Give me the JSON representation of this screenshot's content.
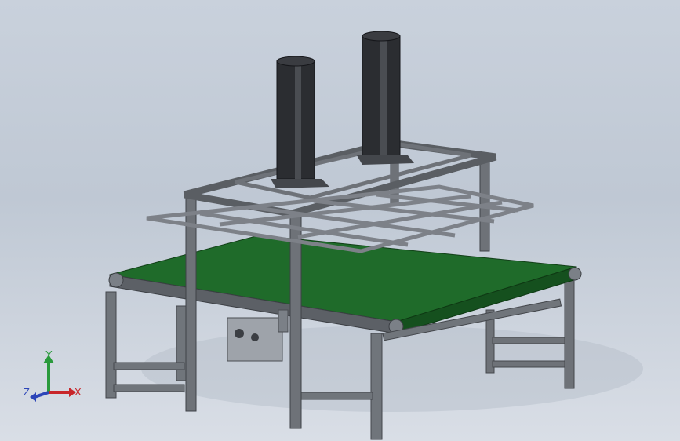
{
  "triad": {
    "x_label": "X",
    "y_label": "Y",
    "z_label": "Z",
    "x_color": "#c8262a",
    "y_color": "#2a9a3c",
    "z_color": "#2c45b8"
  },
  "colors": {
    "frame": "#6e7278",
    "frame_dark": "#4a4d52",
    "belt": "#1f6b2a",
    "belt_dark": "#15501e",
    "cylinder": "#2b2d31",
    "tray": "#8a8e94"
  }
}
